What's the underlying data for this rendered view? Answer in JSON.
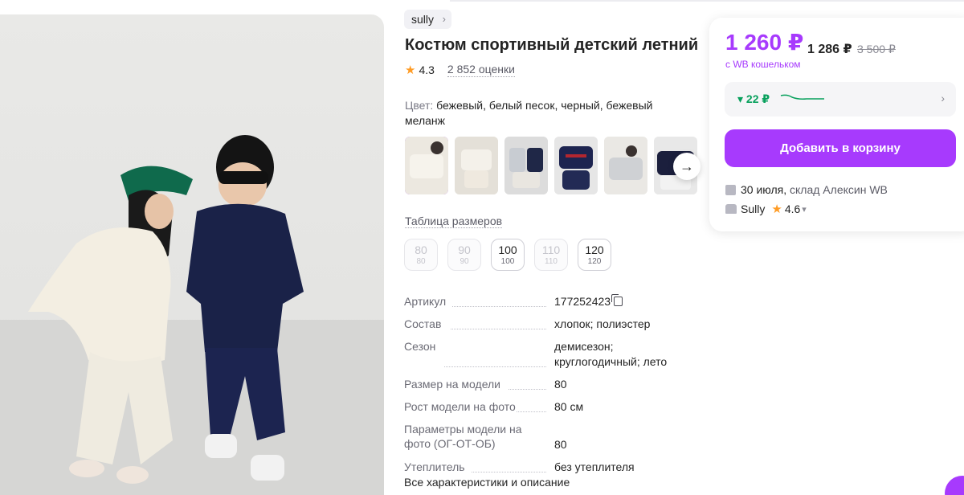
{
  "product": {
    "brand": "sully",
    "title": "Костюм спортивный детский летний",
    "rating": "4.3",
    "reviews": "2 852 оценки",
    "color_label": "Цвет:",
    "color_value": "бежевый, белый песок, черный, бежевый меланж"
  },
  "sizes_link": "Таблица размеров",
  "sizes": [
    {
      "ru": "80",
      "eu": "80",
      "available": false
    },
    {
      "ru": "90",
      "eu": "90",
      "available": false
    },
    {
      "ru": "100",
      "eu": "100",
      "available": true
    },
    {
      "ru": "110",
      "eu": "110",
      "available": false
    },
    {
      "ru": "120",
      "eu": "120",
      "available": true
    }
  ],
  "specs": [
    {
      "key": "Артикул",
      "value": "177252423"
    },
    {
      "key": "Состав",
      "value": "хлопок; полиэстер"
    },
    {
      "key": "Сезон",
      "value": "демисезон; круглогодичный; лето"
    },
    {
      "key": "Размер на модели",
      "value": "80"
    },
    {
      "key": "Рост модели на фото",
      "value": "80 см"
    },
    {
      "key": "Параметры модели на фото (ОГ-ОТ-ОБ)",
      "value": "80"
    },
    {
      "key": "Утеплитель",
      "value": "без утеплителя"
    }
  ],
  "all_specs_link": "Все характеристики и описание",
  "card": {
    "price_wallet": "1 260 ₽",
    "price": "1 286 ₽",
    "price_old": "3 500 ₽",
    "wallet_note": "с WB кошельком",
    "price_drop": "▾ 22 ₽",
    "add_to_cart": "Добавить в корзину",
    "delivery_date": "30 июля,",
    "delivery_place": "склад Алексин WB",
    "seller": "Sully",
    "seller_rating": "4.6"
  },
  "colors": {
    "accent": "#a73afd",
    "green": "#07a05c",
    "star": "#ff9c25"
  }
}
